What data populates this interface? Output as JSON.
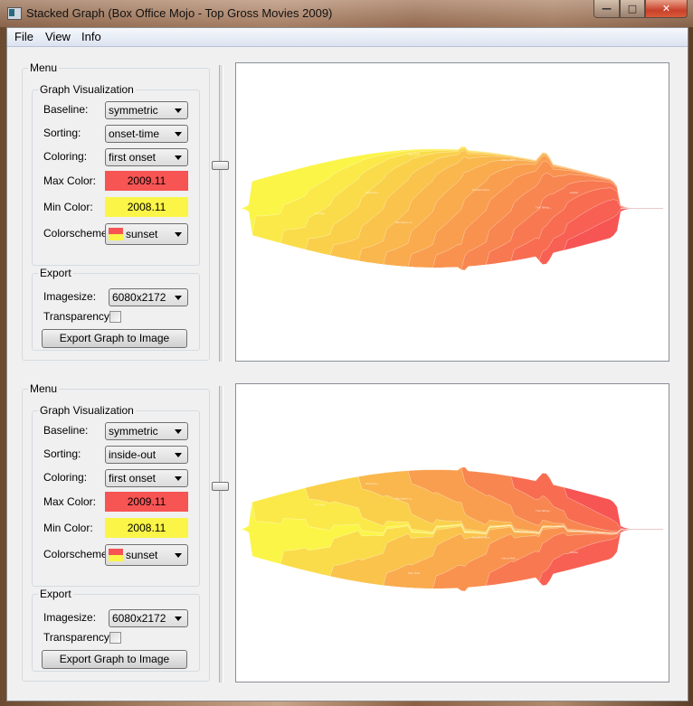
{
  "window": {
    "title": "Stacked Graph (Box Office Mojo - Top Gross Movies 2009)",
    "icon": "app-icon",
    "controls": {
      "minimize": "minimize-icon",
      "maximize": "maximize-icon",
      "close": "close-icon"
    }
  },
  "menubar": {
    "items": [
      "File",
      "View",
      "Info"
    ]
  },
  "panels": [
    {
      "menu_title": "Menu",
      "graph_vis": {
        "title": "Graph Visualization",
        "baseline_label": "Baseline:",
        "baseline_value": "symmetric",
        "sorting_label": "Sorting:",
        "sorting_value": "onset-time",
        "coloring_label": "Coloring:",
        "coloring_value": "first onset",
        "max_color_label": "Max Color:",
        "max_color_value": "2009.11",
        "max_color_hex": "#f75454",
        "min_color_label": "Min Color:",
        "min_color_value": "2008.11",
        "min_color_hex": "#fbf548",
        "colorscheme_label": "Colorscheme:",
        "colorscheme_value": "sunset"
      },
      "export": {
        "title": "Export",
        "imagesize_label": "Imagesize:",
        "imagesize_value": "6080x2172",
        "transparency_label": "Transparency:",
        "transparency_checked": false,
        "export_button": "Export Graph to Image"
      },
      "slider_value": 0.33,
      "graph": {
        "sorting": "onset-time",
        "labels": [
          "Up",
          "Harry Pott...",
          "Transformers",
          "The Twilig...",
          "Avatar",
          "Star Trek",
          "Monsters vs...",
          "2012",
          "Sherlock...",
          "Ice Age"
        ]
      }
    },
    {
      "menu_title": "Menu",
      "graph_vis": {
        "title": "Graph Visualization",
        "baseline_label": "Baseline:",
        "baseline_value": "symmetric",
        "sorting_label": "Sorting:",
        "sorting_value": "inside-out",
        "coloring_label": "Coloring:",
        "coloring_value": "first onset",
        "max_color_label": "Max Color:",
        "max_color_value": "2009.11",
        "max_color_hex": "#f75454",
        "min_color_label": "Min Color:",
        "min_color_value": "2008.11",
        "min_color_hex": "#fbf548",
        "colorscheme_label": "Colorscheme:",
        "colorscheme_value": "sunset"
      },
      "export": {
        "title": "Export",
        "imagesize_label": "Imagesize:",
        "imagesize_value": "6080x2172",
        "transparency_label": "Transparency:",
        "transparency_checked": false,
        "export_button": "Export Graph to Image"
      },
      "slider_value": 0.33,
      "graph": {
        "sorting": "inside-out",
        "labels": [
          "Up",
          "Harry Pott...",
          "Transformers",
          "The Twilig...",
          "Avatar",
          "Star Trek",
          "Monsters vs...",
          "2012",
          "Sherlock...",
          "Ice Age"
        ]
      }
    }
  ]
}
